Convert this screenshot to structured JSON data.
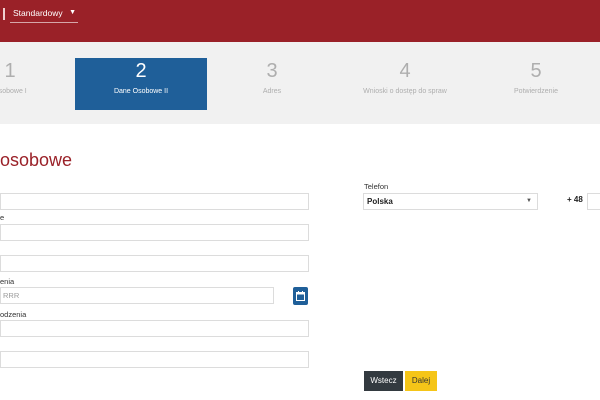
{
  "header": {
    "contrast_value": "Standardowy",
    "colors": {
      "brand": "#9a2128",
      "accent": "#1f5f99",
      "next": "#f5c518"
    }
  },
  "steps": [
    {
      "number": "1",
      "label": "Osobowe I",
      "active": false
    },
    {
      "number": "2",
      "label": "Dane Osobowe II",
      "active": true
    },
    {
      "number": "3",
      "label": "Adres",
      "active": false
    },
    {
      "number": "4",
      "label": "Wnioski o dostęp do spraw",
      "active": false
    },
    {
      "number": "5",
      "label": "Potwierdzenie",
      "active": false
    }
  ],
  "form": {
    "title": "osobowe",
    "labels": {
      "field2": "e",
      "birthdate": "enia",
      "birthplace": "odzenia"
    },
    "birthdate_placeholder": "RRR"
  },
  "phone": {
    "label": "Telefon",
    "country": "Polska",
    "prefix": "+ 48"
  },
  "buttons": {
    "back": "Wstecz",
    "next": "Dalej"
  },
  "icons": {
    "calendar": "calendar-icon",
    "dropdown": "chevron-down-icon"
  }
}
